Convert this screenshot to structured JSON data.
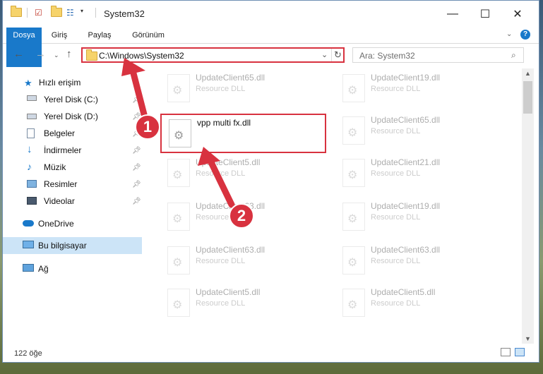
{
  "title": "System32",
  "ribbon_tabs": [
    "Dosya",
    "Giriş",
    "Paylaş",
    "Görünüm"
  ],
  "address": "C:\\Windows\\System32",
  "search_placeholder": "Ara: System32",
  "sidebar": [
    {
      "label": "Hızlı erişim",
      "icon": "star-icon",
      "pinned": false
    },
    {
      "label": "Yerel Disk (C:)",
      "icon": "drive-icon",
      "pinned": true
    },
    {
      "label": "Yerel Disk (D:)",
      "icon": "drive-icon",
      "pinned": true
    },
    {
      "label": "Belgeler",
      "icon": "documents-icon",
      "pinned": true
    },
    {
      "label": "İndirmeler",
      "icon": "download-icon",
      "pinned": true
    },
    {
      "label": "Müzik",
      "icon": "music-icon",
      "pinned": true
    },
    {
      "label": "Resimler",
      "icon": "pictures-icon",
      "pinned": true
    },
    {
      "label": "Videolar",
      "icon": "videos-icon",
      "pinned": true
    },
    {
      "label": "OneDrive",
      "icon": "cloud-icon",
      "pinned": false
    },
    {
      "label": "Bu bilgisayar",
      "icon": "computer-icon",
      "pinned": false,
      "selected": true
    },
    {
      "label": "Ağ",
      "icon": "network-icon",
      "pinned": false
    }
  ],
  "files_left": [
    {
      "name": "UpdateClient65.dll",
      "type": "Resource DLL"
    },
    {
      "name": "vpp multi fx.dll",
      "type": ""
    },
    {
      "name": "UpdateClient5.dll",
      "type": "Resource DLL"
    },
    {
      "name": "UpdateClient63.dll",
      "type": "Resource DLL"
    },
    {
      "name": "UpdateClient63.dll",
      "type": "Resource DLL"
    },
    {
      "name": "UpdateClient5.dll",
      "type": "Resource DLL"
    }
  ],
  "files_right": [
    {
      "name": "UpdateClient19.dll",
      "type": "Resource DLL"
    },
    {
      "name": "UpdateClient65.dll",
      "type": "Resource DLL"
    },
    {
      "name": "UpdateClient21.dll",
      "type": "Resource DLL"
    },
    {
      "name": "UpdateClient19.dll",
      "type": "Resource DLL"
    },
    {
      "name": "UpdateClient63.dll",
      "type": "Resource DLL"
    },
    {
      "name": "UpdateClient5.dll",
      "type": "Resource DLL"
    }
  ],
  "status": "122 öğe",
  "callouts": [
    "1",
    "2"
  ],
  "accent": "#d8323f",
  "file_tab_color": "#1979ca"
}
